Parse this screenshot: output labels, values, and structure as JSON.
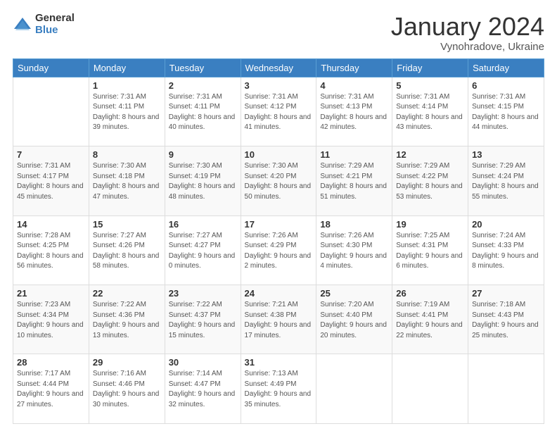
{
  "logo": {
    "general": "General",
    "blue": "Blue"
  },
  "title": {
    "month_year": "January 2024",
    "location": "Vynohradove, Ukraine"
  },
  "weekdays": [
    "Sunday",
    "Monday",
    "Tuesday",
    "Wednesday",
    "Thursday",
    "Friday",
    "Saturday"
  ],
  "weeks": [
    [
      {
        "day": "",
        "sunrise": "",
        "sunset": "",
        "daylight": ""
      },
      {
        "day": "1",
        "sunrise": "Sunrise: 7:31 AM",
        "sunset": "Sunset: 4:11 PM",
        "daylight": "Daylight: 8 hours and 39 minutes."
      },
      {
        "day": "2",
        "sunrise": "Sunrise: 7:31 AM",
        "sunset": "Sunset: 4:11 PM",
        "daylight": "Daylight: 8 hours and 40 minutes."
      },
      {
        "day": "3",
        "sunrise": "Sunrise: 7:31 AM",
        "sunset": "Sunset: 4:12 PM",
        "daylight": "Daylight: 8 hours and 41 minutes."
      },
      {
        "day": "4",
        "sunrise": "Sunrise: 7:31 AM",
        "sunset": "Sunset: 4:13 PM",
        "daylight": "Daylight: 8 hours and 42 minutes."
      },
      {
        "day": "5",
        "sunrise": "Sunrise: 7:31 AM",
        "sunset": "Sunset: 4:14 PM",
        "daylight": "Daylight: 8 hours and 43 minutes."
      },
      {
        "day": "6",
        "sunrise": "Sunrise: 7:31 AM",
        "sunset": "Sunset: 4:15 PM",
        "daylight": "Daylight: 8 hours and 44 minutes."
      }
    ],
    [
      {
        "day": "7",
        "sunrise": "Sunrise: 7:31 AM",
        "sunset": "Sunset: 4:17 PM",
        "daylight": "Daylight: 8 hours and 45 minutes."
      },
      {
        "day": "8",
        "sunrise": "Sunrise: 7:30 AM",
        "sunset": "Sunset: 4:18 PM",
        "daylight": "Daylight: 8 hours and 47 minutes."
      },
      {
        "day": "9",
        "sunrise": "Sunrise: 7:30 AM",
        "sunset": "Sunset: 4:19 PM",
        "daylight": "Daylight: 8 hours and 48 minutes."
      },
      {
        "day": "10",
        "sunrise": "Sunrise: 7:30 AM",
        "sunset": "Sunset: 4:20 PM",
        "daylight": "Daylight: 8 hours and 50 minutes."
      },
      {
        "day": "11",
        "sunrise": "Sunrise: 7:29 AM",
        "sunset": "Sunset: 4:21 PM",
        "daylight": "Daylight: 8 hours and 51 minutes."
      },
      {
        "day": "12",
        "sunrise": "Sunrise: 7:29 AM",
        "sunset": "Sunset: 4:22 PM",
        "daylight": "Daylight: 8 hours and 53 minutes."
      },
      {
        "day": "13",
        "sunrise": "Sunrise: 7:29 AM",
        "sunset": "Sunset: 4:24 PM",
        "daylight": "Daylight: 8 hours and 55 minutes."
      }
    ],
    [
      {
        "day": "14",
        "sunrise": "Sunrise: 7:28 AM",
        "sunset": "Sunset: 4:25 PM",
        "daylight": "Daylight: 8 hours and 56 minutes."
      },
      {
        "day": "15",
        "sunrise": "Sunrise: 7:27 AM",
        "sunset": "Sunset: 4:26 PM",
        "daylight": "Daylight: 8 hours and 58 minutes."
      },
      {
        "day": "16",
        "sunrise": "Sunrise: 7:27 AM",
        "sunset": "Sunset: 4:27 PM",
        "daylight": "Daylight: 9 hours and 0 minutes."
      },
      {
        "day": "17",
        "sunrise": "Sunrise: 7:26 AM",
        "sunset": "Sunset: 4:29 PM",
        "daylight": "Daylight: 9 hours and 2 minutes."
      },
      {
        "day": "18",
        "sunrise": "Sunrise: 7:26 AM",
        "sunset": "Sunset: 4:30 PM",
        "daylight": "Daylight: 9 hours and 4 minutes."
      },
      {
        "day": "19",
        "sunrise": "Sunrise: 7:25 AM",
        "sunset": "Sunset: 4:31 PM",
        "daylight": "Daylight: 9 hours and 6 minutes."
      },
      {
        "day": "20",
        "sunrise": "Sunrise: 7:24 AM",
        "sunset": "Sunset: 4:33 PM",
        "daylight": "Daylight: 9 hours and 8 minutes."
      }
    ],
    [
      {
        "day": "21",
        "sunrise": "Sunrise: 7:23 AM",
        "sunset": "Sunset: 4:34 PM",
        "daylight": "Daylight: 9 hours and 10 minutes."
      },
      {
        "day": "22",
        "sunrise": "Sunrise: 7:22 AM",
        "sunset": "Sunset: 4:36 PM",
        "daylight": "Daylight: 9 hours and 13 minutes."
      },
      {
        "day": "23",
        "sunrise": "Sunrise: 7:22 AM",
        "sunset": "Sunset: 4:37 PM",
        "daylight": "Daylight: 9 hours and 15 minutes."
      },
      {
        "day": "24",
        "sunrise": "Sunrise: 7:21 AM",
        "sunset": "Sunset: 4:38 PM",
        "daylight": "Daylight: 9 hours and 17 minutes."
      },
      {
        "day": "25",
        "sunrise": "Sunrise: 7:20 AM",
        "sunset": "Sunset: 4:40 PM",
        "daylight": "Daylight: 9 hours and 20 minutes."
      },
      {
        "day": "26",
        "sunrise": "Sunrise: 7:19 AM",
        "sunset": "Sunset: 4:41 PM",
        "daylight": "Daylight: 9 hours and 22 minutes."
      },
      {
        "day": "27",
        "sunrise": "Sunrise: 7:18 AM",
        "sunset": "Sunset: 4:43 PM",
        "daylight": "Daylight: 9 hours and 25 minutes."
      }
    ],
    [
      {
        "day": "28",
        "sunrise": "Sunrise: 7:17 AM",
        "sunset": "Sunset: 4:44 PM",
        "daylight": "Daylight: 9 hours and 27 minutes."
      },
      {
        "day": "29",
        "sunrise": "Sunrise: 7:16 AM",
        "sunset": "Sunset: 4:46 PM",
        "daylight": "Daylight: 9 hours and 30 minutes."
      },
      {
        "day": "30",
        "sunrise": "Sunrise: 7:14 AM",
        "sunset": "Sunset: 4:47 PM",
        "daylight": "Daylight: 9 hours and 32 minutes."
      },
      {
        "day": "31",
        "sunrise": "Sunrise: 7:13 AM",
        "sunset": "Sunset: 4:49 PM",
        "daylight": "Daylight: 9 hours and 35 minutes."
      },
      {
        "day": "",
        "sunrise": "",
        "sunset": "",
        "daylight": ""
      },
      {
        "day": "",
        "sunrise": "",
        "sunset": "",
        "daylight": ""
      },
      {
        "day": "",
        "sunrise": "",
        "sunset": "",
        "daylight": ""
      }
    ]
  ]
}
